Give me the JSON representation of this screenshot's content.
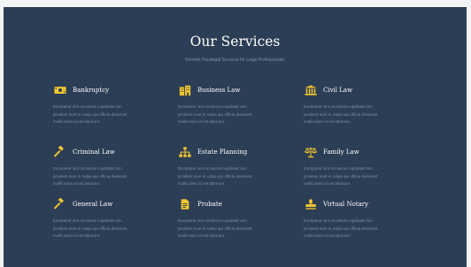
{
  "section": {
    "title": "Our Services",
    "subtitle": "Remote Paralegal Services for Legal Professionals"
  },
  "accent_color": "#f2c62f",
  "services": [
    {
      "name": "Bankruptcy",
      "icon": "money-icon",
      "desc_lines": [
        "Excepteur sint occaecat cupidatat non",
        "proident sunt in culpa qui officia deserunt",
        "mollit anim id est laborum."
      ]
    },
    {
      "name": "Business Law",
      "icon": "buildings-icon",
      "desc_lines": [
        "Excepteur sint occaecat cupidatat non",
        "proident sunt in culpa qui officia deserunt",
        "mollit anim id est laborum."
      ]
    },
    {
      "name": "Civil Law",
      "icon": "courthouse-icon",
      "desc_lines": [
        "Excepteur sint occaecat cupidatat non",
        "proident sunt in culpa qui officia deserunt",
        "mollit anim id est laborum."
      ]
    },
    {
      "name": "Criminal Law",
      "icon": "gavel-icon",
      "desc_lines": [
        "Excepteur sint occaecat cupidatat non",
        "proident sunt in culpa qui officia deserunt",
        "mollit anim id est laborum."
      ]
    },
    {
      "name": "Estate Planning",
      "icon": "org-chart-icon",
      "desc_lines": [
        "Excepteur sint occaecat cupidatat non",
        "proident sunt in culpa qui officia deserunt",
        "mollit anim id est laborum."
      ]
    },
    {
      "name": "Family Law",
      "icon": "scales-icon",
      "desc_lines": [
        "Excepteur sint occaecat cupidatat non",
        "proident sunt in culpa qui officia deserunt",
        "mollit anim id est laborum."
      ]
    },
    {
      "name": "General Law",
      "icon": "gavel-icon",
      "desc_lines": [
        "Excepteur sint occaecat cupidatat non",
        "proident sunt in culpa qui officia deserunt",
        "mollit anim id est laborum."
      ]
    },
    {
      "name": "Probate",
      "icon": "document-icon",
      "desc_lines": [
        "Excepteur sint occaecat cupidatat non",
        "proident sunt in culpa qui officia deserunt",
        "mollit anim id est laborum."
      ]
    },
    {
      "name": "Virtual Notary",
      "icon": "stamp-icon",
      "desc_lines": [
        "Excepteur sint occaecat cupidatat non",
        "proident sunt in culpa qui officia deserunt",
        "mollit anim id est laborum."
      ]
    }
  ]
}
